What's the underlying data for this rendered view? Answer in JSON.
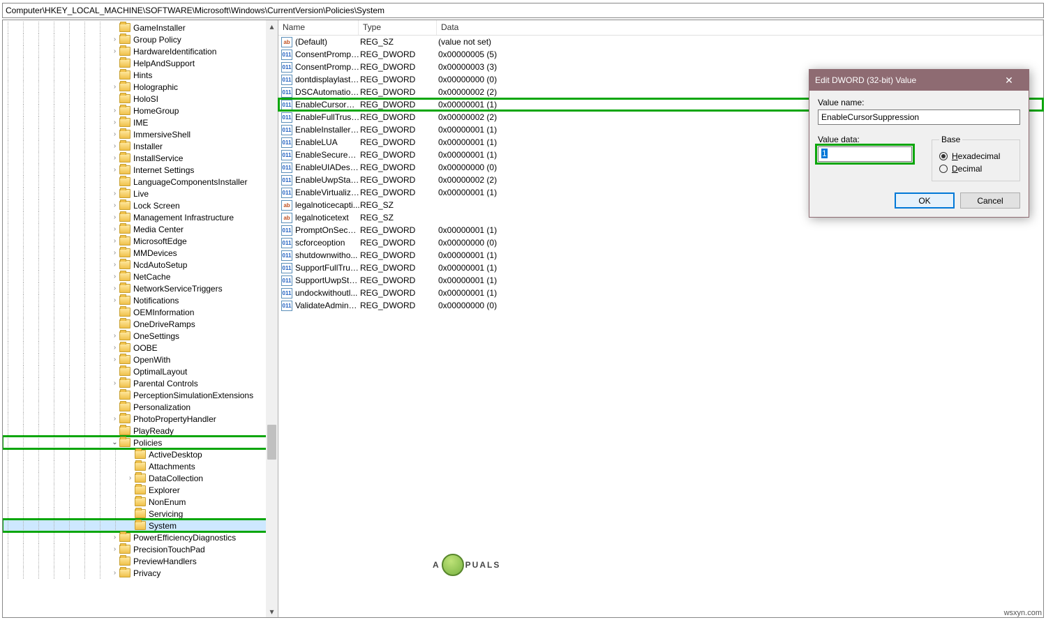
{
  "address_bar": "Computer\\HKEY_LOCAL_MACHINE\\SOFTWARE\\Microsoft\\Windows\\CurrentVersion\\Policies\\System",
  "columns": {
    "name": "Name",
    "type": "Type",
    "data": "Data"
  },
  "tree": [
    {
      "label": "GameInstaller",
      "indent": 7,
      "exp": ""
    },
    {
      "label": "Group Policy",
      "indent": 7,
      "exp": ">"
    },
    {
      "label": "HardwareIdentification",
      "indent": 7,
      "exp": ">"
    },
    {
      "label": "HelpAndSupport",
      "indent": 7,
      "exp": ""
    },
    {
      "label": "Hints",
      "indent": 7,
      "exp": ""
    },
    {
      "label": "Holographic",
      "indent": 7,
      "exp": ">"
    },
    {
      "label": "HoloSI",
      "indent": 7,
      "exp": ""
    },
    {
      "label": "HomeGroup",
      "indent": 7,
      "exp": ">"
    },
    {
      "label": "IME",
      "indent": 7,
      "exp": ">"
    },
    {
      "label": "ImmersiveShell",
      "indent": 7,
      "exp": ">"
    },
    {
      "label": "Installer",
      "indent": 7,
      "exp": ">"
    },
    {
      "label": "InstallService",
      "indent": 7,
      "exp": ">"
    },
    {
      "label": "Internet Settings",
      "indent": 7,
      "exp": ">"
    },
    {
      "label": "LanguageComponentsInstaller",
      "indent": 7,
      "exp": ""
    },
    {
      "label": "Live",
      "indent": 7,
      "exp": ">"
    },
    {
      "label": "Lock Screen",
      "indent": 7,
      "exp": ">"
    },
    {
      "label": "Management Infrastructure",
      "indent": 7,
      "exp": ">"
    },
    {
      "label": "Media Center",
      "indent": 7,
      "exp": ">"
    },
    {
      "label": "MicrosoftEdge",
      "indent": 7,
      "exp": ">"
    },
    {
      "label": "MMDevices",
      "indent": 7,
      "exp": ">"
    },
    {
      "label": "NcdAutoSetup",
      "indent": 7,
      "exp": ">"
    },
    {
      "label": "NetCache",
      "indent": 7,
      "exp": ">"
    },
    {
      "label": "NetworkServiceTriggers",
      "indent": 7,
      "exp": ">"
    },
    {
      "label": "Notifications",
      "indent": 7,
      "exp": ">"
    },
    {
      "label": "OEMInformation",
      "indent": 7,
      "exp": ""
    },
    {
      "label": "OneDriveRamps",
      "indent": 7,
      "exp": ""
    },
    {
      "label": "OneSettings",
      "indent": 7,
      "exp": ">"
    },
    {
      "label": "OOBE",
      "indent": 7,
      "exp": ">"
    },
    {
      "label": "OpenWith",
      "indent": 7,
      "exp": ">"
    },
    {
      "label": "OptimalLayout",
      "indent": 7,
      "exp": ""
    },
    {
      "label": "Parental Controls",
      "indent": 7,
      "exp": ">"
    },
    {
      "label": "PerceptionSimulationExtensions",
      "indent": 7,
      "exp": ""
    },
    {
      "label": "Personalization",
      "indent": 7,
      "exp": ""
    },
    {
      "label": "PhotoPropertyHandler",
      "indent": 7,
      "exp": ">"
    },
    {
      "label": "PlayReady",
      "indent": 7,
      "exp": ""
    },
    {
      "label": "Policies",
      "indent": 7,
      "exp": "v",
      "green": true
    },
    {
      "label": "ActiveDesktop",
      "indent": 8,
      "exp": ""
    },
    {
      "label": "Attachments",
      "indent": 8,
      "exp": ""
    },
    {
      "label": "DataCollection",
      "indent": 8,
      "exp": ">"
    },
    {
      "label": "Explorer",
      "indent": 8,
      "exp": ""
    },
    {
      "label": "NonEnum",
      "indent": 8,
      "exp": ""
    },
    {
      "label": "Servicing",
      "indent": 8,
      "exp": ""
    },
    {
      "label": "System",
      "indent": 8,
      "exp": "",
      "green": true,
      "selected": true
    },
    {
      "label": "PowerEfficiencyDiagnostics",
      "indent": 7,
      "exp": ">"
    },
    {
      "label": "PrecisionTouchPad",
      "indent": 7,
      "exp": ">"
    },
    {
      "label": "PreviewHandlers",
      "indent": 7,
      "exp": ""
    },
    {
      "label": "Privacy",
      "indent": 7,
      "exp": ">"
    }
  ],
  "values": [
    {
      "icon": "sz",
      "name": "(Default)",
      "type": "REG_SZ",
      "data": "(value not set)"
    },
    {
      "icon": "dw",
      "name": "ConsentPrompt...",
      "type": "REG_DWORD",
      "data": "0x00000005 (5)"
    },
    {
      "icon": "dw",
      "name": "ConsentPrompt...",
      "type": "REG_DWORD",
      "data": "0x00000003 (3)"
    },
    {
      "icon": "dw",
      "name": "dontdisplaylastu...",
      "type": "REG_DWORD",
      "data": "0x00000000 (0)"
    },
    {
      "icon": "dw",
      "name": "DSCAutomation...",
      "type": "REG_DWORD",
      "data": "0x00000002 (2)"
    },
    {
      "icon": "dw",
      "name": "EnableCursorSu...",
      "type": "REG_DWORD",
      "data": "0x00000001 (1)",
      "green": true
    },
    {
      "icon": "dw",
      "name": "EnableFullTrustS...",
      "type": "REG_DWORD",
      "data": "0x00000002 (2)"
    },
    {
      "icon": "dw",
      "name": "EnableInstallerD...",
      "type": "REG_DWORD",
      "data": "0x00000001 (1)"
    },
    {
      "icon": "dw",
      "name": "EnableLUA",
      "type": "REG_DWORD",
      "data": "0x00000001 (1)"
    },
    {
      "icon": "dw",
      "name": "EnableSecureUI...",
      "type": "REG_DWORD",
      "data": "0x00000001 (1)"
    },
    {
      "icon": "dw",
      "name": "EnableUIADeskt...",
      "type": "REG_DWORD",
      "data": "0x00000000 (0)"
    },
    {
      "icon": "dw",
      "name": "EnableUwpStart...",
      "type": "REG_DWORD",
      "data": "0x00000002 (2)"
    },
    {
      "icon": "dw",
      "name": "EnableVirtualizat...",
      "type": "REG_DWORD",
      "data": "0x00000001 (1)"
    },
    {
      "icon": "sz",
      "name": "legalnoticecapti...",
      "type": "REG_SZ",
      "data": ""
    },
    {
      "icon": "sz",
      "name": "legalnoticetext",
      "type": "REG_SZ",
      "data": ""
    },
    {
      "icon": "dw",
      "name": "PromptOnSecur...",
      "type": "REG_DWORD",
      "data": "0x00000001 (1)"
    },
    {
      "icon": "dw",
      "name": "scforceoption",
      "type": "REG_DWORD",
      "data": "0x00000000 (0)"
    },
    {
      "icon": "dw",
      "name": "shutdownwitho...",
      "type": "REG_DWORD",
      "data": "0x00000001 (1)"
    },
    {
      "icon": "dw",
      "name": "SupportFullTrust...",
      "type": "REG_DWORD",
      "data": "0x00000001 (1)"
    },
    {
      "icon": "dw",
      "name": "SupportUwpStar...",
      "type": "REG_DWORD",
      "data": "0x00000001 (1)"
    },
    {
      "icon": "dw",
      "name": "undockwithoutl...",
      "type": "REG_DWORD",
      "data": "0x00000001 (1)"
    },
    {
      "icon": "dw",
      "name": "ValidateAdminC...",
      "type": "REG_DWORD",
      "data": "0x00000000 (0)"
    }
  ],
  "dialog": {
    "title": "Edit DWORD (32-bit) Value",
    "value_name_label": "Value name:",
    "value_name": "EnableCursorSuppression",
    "value_data_label": "Value data:",
    "value_data": "1",
    "base_label": "Base",
    "hex_label": "Hexadecimal",
    "dec_label": "Decimal",
    "ok": "OK",
    "cancel": "Cancel"
  },
  "watermark": {
    "pre": "A",
    "post": "PUALS"
  },
  "credit": "wsxyn.com"
}
